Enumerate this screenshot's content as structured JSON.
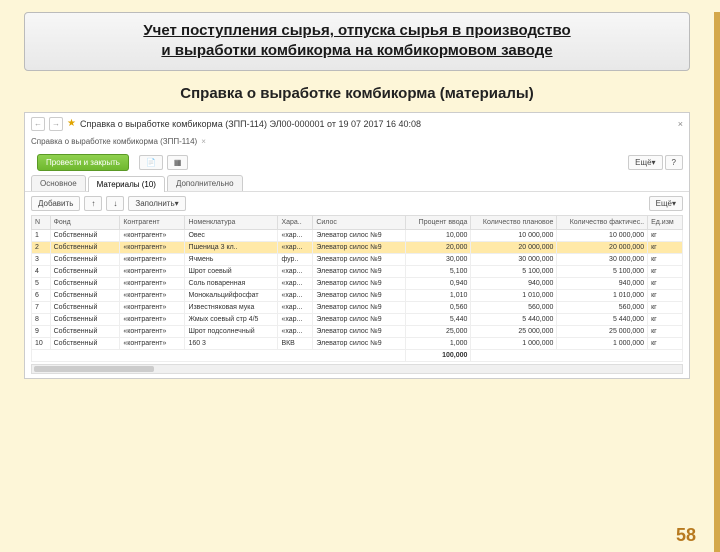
{
  "slide": {
    "title_line1": "Учет поступления сырья, отпуска сырья в производство",
    "title_line2": "и выработки комбикорма на комбикормовом заводе",
    "subtitle": "Справка о выработке комбикорма (материалы)",
    "page_number": "58"
  },
  "window": {
    "title": "Справка о выработке комбикорма (ЗПП-114) ЭЛ00-000001 от 19 07 2017 16 40:08",
    "breadcrumb": "Справка о выработке комбикорма (ЗПП-114)",
    "close": "×",
    "more_label": "Ещё"
  },
  "buttons": {
    "post_close": "Провести и закрыть",
    "add": "Добавить",
    "fill": "Заполнить"
  },
  "tabs": [
    {
      "label": "Основное",
      "active": false
    },
    {
      "label": "Материалы (10)",
      "active": true
    },
    {
      "label": "Дополнительно",
      "active": false
    }
  ],
  "columns": [
    "N",
    "Фонд",
    "Контрагент",
    "Номенклатура",
    "Хара..",
    "Силос",
    "Процент ввода",
    "Количество плановое",
    "Количество фактичес..",
    "Ед.изм"
  ],
  "rows": [
    {
      "n": "1",
      "fund": "Собственный",
      "agent": "«контрагент»",
      "nom": "Овес",
      "char": "«хар...",
      "silo": "Элеватор силос №9",
      "pct": "10,000",
      "plan": "10 000,000",
      "fact": "10 000,000",
      "unit": "кг",
      "hl": false
    },
    {
      "n": "2",
      "fund": "Собственный",
      "agent": "«контрагент»",
      "nom": "Пшеница 3 кл..",
      "char": "«хар...",
      "silo": "Элеватор силос №9",
      "pct": "20,000",
      "plan": "20 000,000",
      "fact": "20 000,000",
      "unit": "кг",
      "hl": true
    },
    {
      "n": "3",
      "fund": "Собственный",
      "agent": "«контрагент»",
      "nom": "Ячмень",
      "char": "фур..",
      "silo": "Элеватор силос №9",
      "pct": "30,000",
      "plan": "30 000,000",
      "fact": "30 000,000",
      "unit": "кг",
      "hl": false
    },
    {
      "n": "4",
      "fund": "Собственный",
      "agent": "«контрагент»",
      "nom": "Шрот соевый",
      "char": "«хар...",
      "silo": "Элеватор силос №9",
      "pct": "5,100",
      "plan": "5 100,000",
      "fact": "5 100,000",
      "unit": "кг",
      "hl": false
    },
    {
      "n": "5",
      "fund": "Собственный",
      "agent": "«контрагент»",
      "nom": "Соль поваренная",
      "char": "«хар...",
      "silo": "Элеватор силос №9",
      "pct": "0,940",
      "plan": "940,000",
      "fact": "940,000",
      "unit": "кг",
      "hl": false
    },
    {
      "n": "6",
      "fund": "Собственный",
      "agent": "«контрагент»",
      "nom": "Монокальцийфосфат",
      "char": "«хар...",
      "silo": "Элеватор силос №9",
      "pct": "1,010",
      "plan": "1 010,000",
      "fact": "1 010,000",
      "unit": "кг",
      "hl": false
    },
    {
      "n": "7",
      "fund": "Собственный",
      "agent": "«контрагент»",
      "nom": "Известняковая мука",
      "char": "«хар...",
      "silo": "Элеватор силос №9",
      "pct": "0,560",
      "plan": "560,000",
      "fact": "560,000",
      "unit": "кг",
      "hl": false
    },
    {
      "n": "8",
      "fund": "Собственный",
      "agent": "«контрагент»",
      "nom": "Жмых соевый стр 4/5",
      "char": "«хар...",
      "silo": "Элеватор силос №9",
      "pct": "5,440",
      "plan": "5 440,000",
      "fact": "5 440,000",
      "unit": "кг",
      "hl": false
    },
    {
      "n": "9",
      "fund": "Собственный",
      "agent": "«контрагент»",
      "nom": "Шрот подсолнечный",
      "char": "«хар...",
      "silo": "Элеватор силос №9",
      "pct": "25,000",
      "plan": "25 000,000",
      "fact": "25 000,000",
      "unit": "кг",
      "hl": false
    },
    {
      "n": "10",
      "fund": "Собственный",
      "agent": "«контрагент»",
      "nom": "160 3",
      "char": "ВКВ",
      "silo": "Элеватор силос №9",
      "pct": "1,000",
      "plan": "1 000,000",
      "fact": "1 000,000",
      "unit": "кг",
      "hl": false
    }
  ],
  "footer_total": "100,000",
  "chev": "▾"
}
